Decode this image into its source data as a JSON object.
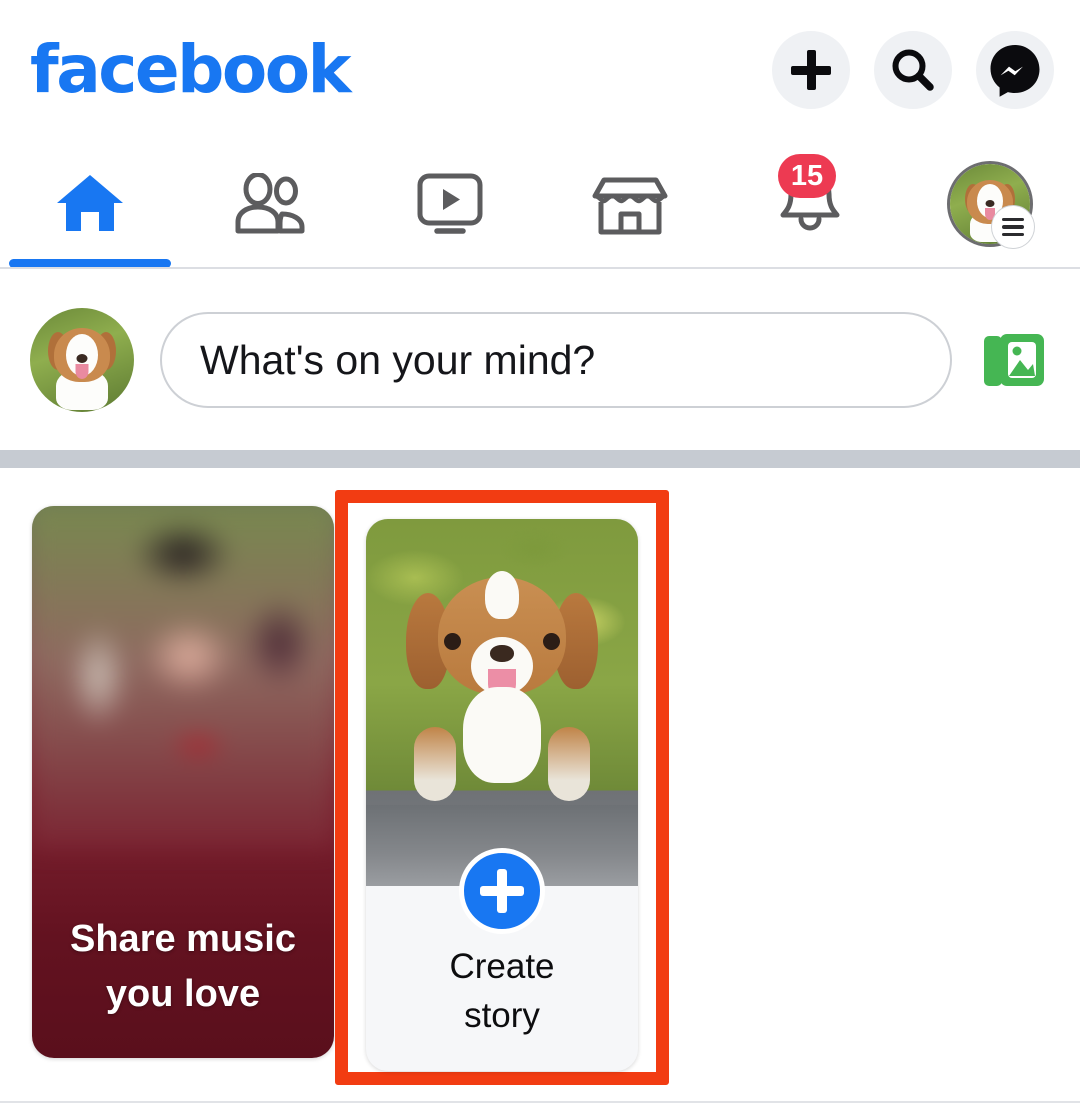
{
  "app": {
    "brand": "facebook",
    "platform": "Facebook mobile app home feed"
  },
  "topbar": {
    "actions": [
      {
        "name": "create-button",
        "icon": "plus-icon",
        "label": "Create"
      },
      {
        "name": "search-button",
        "icon": "search-icon",
        "label": "Search"
      },
      {
        "name": "messenger-button",
        "icon": "messenger-icon",
        "label": "Messenger"
      }
    ]
  },
  "navbar": {
    "tabs": [
      {
        "name": "home",
        "icon": "home-icon",
        "label": "Home",
        "active": true
      },
      {
        "name": "friends",
        "icon": "friends-icon",
        "label": "Friends",
        "active": false
      },
      {
        "name": "video",
        "icon": "video-icon",
        "label": "Video",
        "active": false
      },
      {
        "name": "marketplace",
        "icon": "marketplace-icon",
        "label": "Marketplace",
        "active": false
      },
      {
        "name": "notifications",
        "icon": "bell-icon",
        "label": "Notifications",
        "active": false,
        "badge": "15"
      },
      {
        "name": "menu",
        "icon": "profile-avatar",
        "label": "Menu",
        "active": false
      }
    ],
    "notification_count": "15",
    "active_indicator_color": "#1877F2"
  },
  "composer": {
    "avatar_alt": "Profile photo of a puppy",
    "placeholder": "What's on your mind?",
    "photo_button_label": "Photo",
    "photo_icon": "gallery-icon"
  },
  "stories": [
    {
      "name": "share-music-story",
      "title_line1": "Share music",
      "title_line2": "you love",
      "type": "music-promo"
    },
    {
      "name": "create-story-card",
      "title_line1": "Create",
      "title_line2": "story",
      "type": "create",
      "action_icon": "plus-icon",
      "highlighted": true
    }
  ],
  "annotation": {
    "target": "create-story-card",
    "color": "#F23C12",
    "shape": "rectangle-outline"
  },
  "colors": {
    "brand_blue": "#1877F2",
    "badge_red": "#ED3A52",
    "annotation_red": "#F23C12",
    "icon_gray": "#5C5C5E",
    "separator_gray": "#C6CBD2",
    "button_bg": "#EFF1F4",
    "music_card_maroon": "#5A0F1C"
  }
}
